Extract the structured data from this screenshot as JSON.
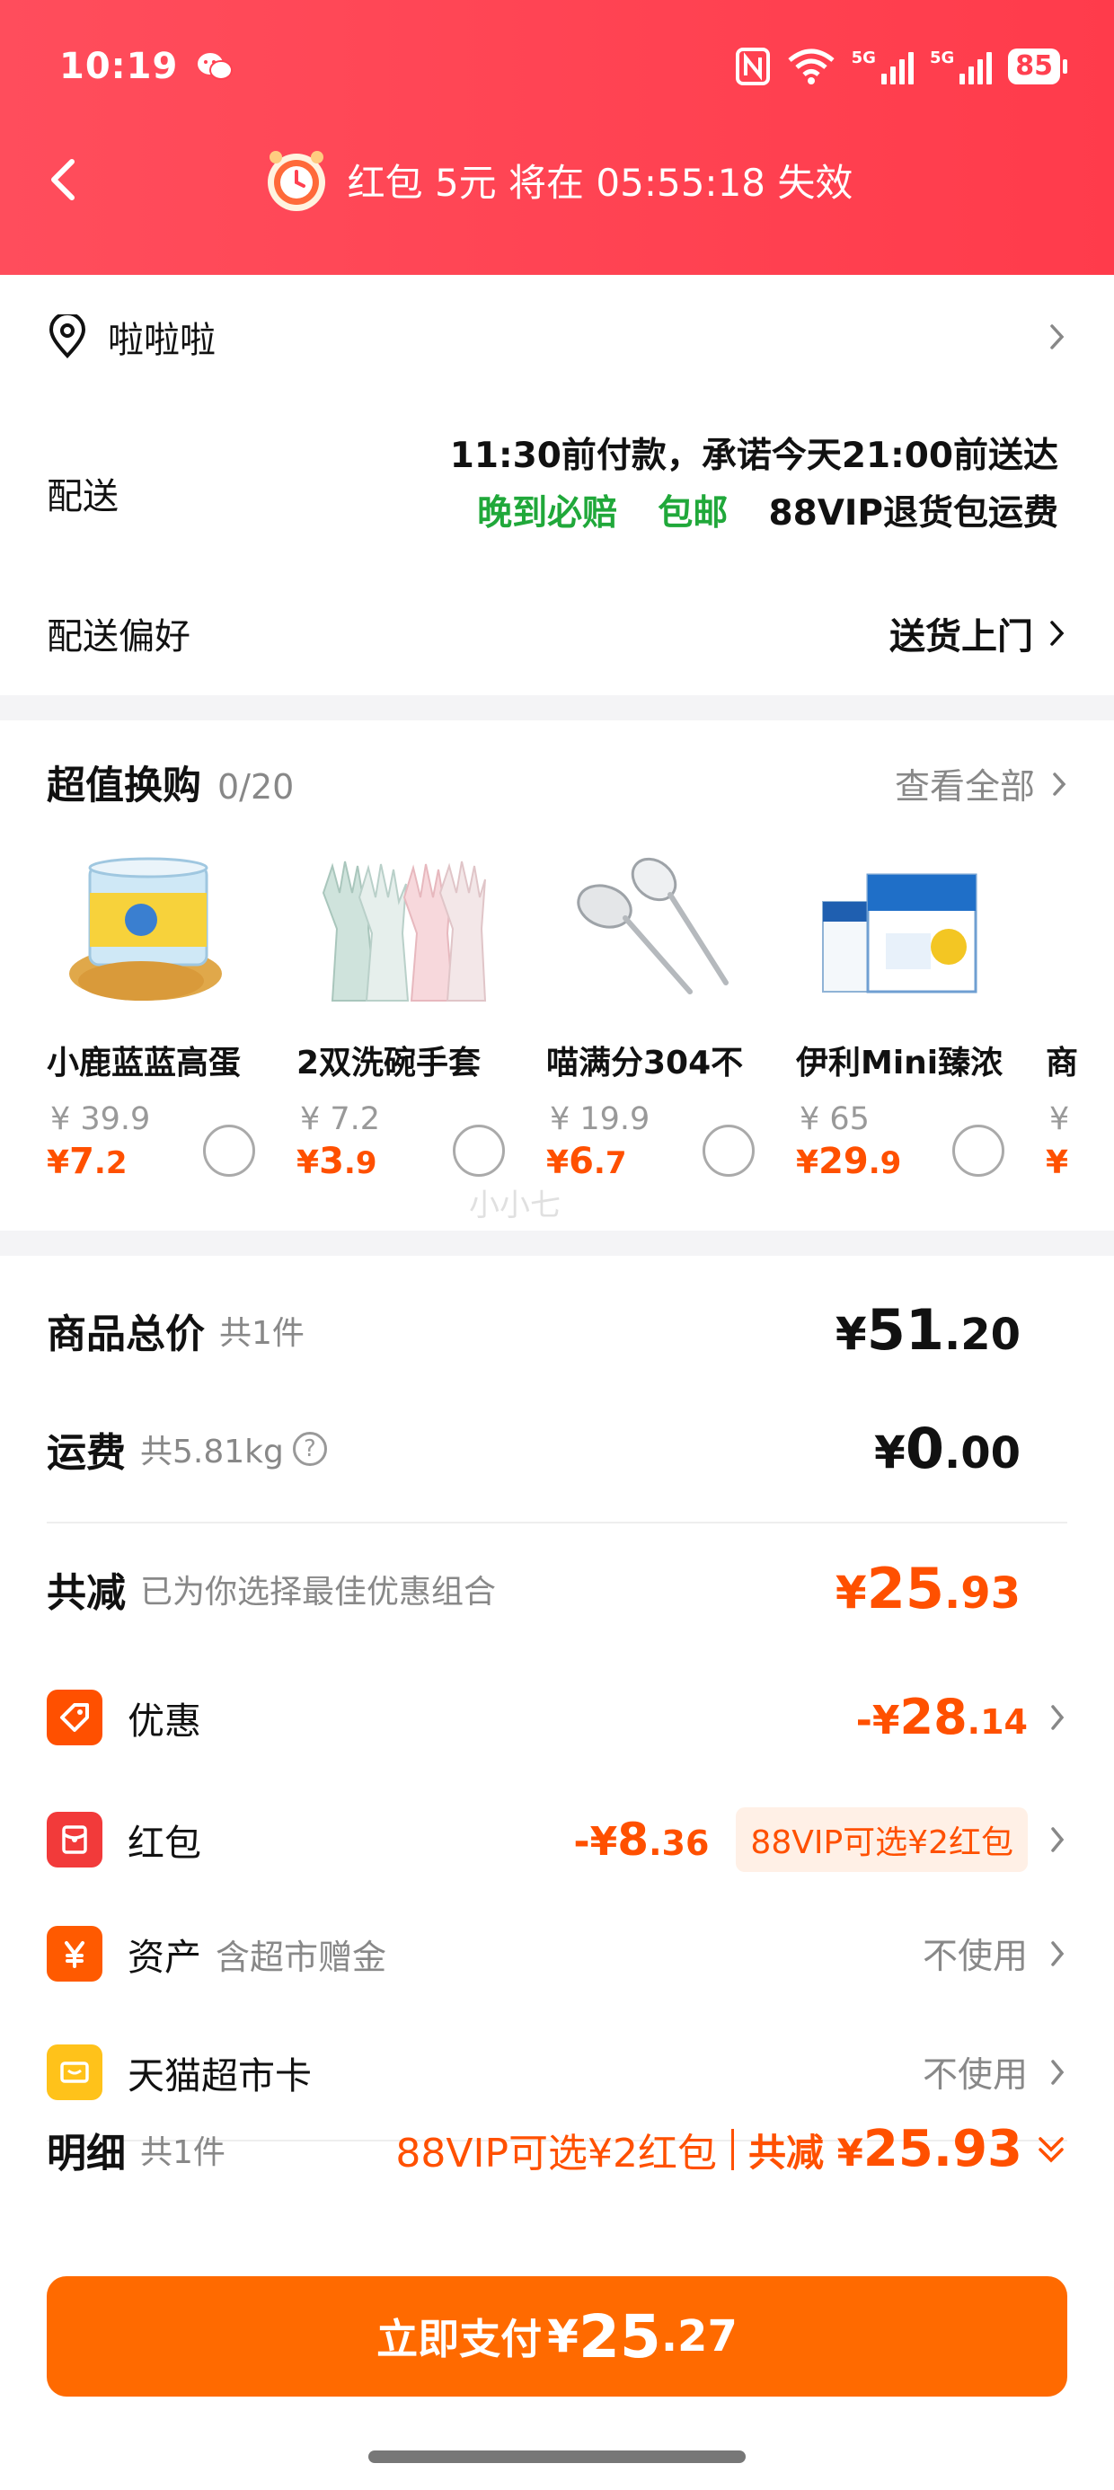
{
  "status_bar": {
    "time": "10:19",
    "signal_tag_1": "5G",
    "signal_tag_2": "5G",
    "battery": "85"
  },
  "nav": {
    "red_packet_text": "红包 5元 将在 05:55:18 失效"
  },
  "address": {
    "name": "啦啦啦"
  },
  "delivery": {
    "label": "配送",
    "line1": "11:30前付款，承诺今天21:00前送达",
    "badge1": "晚到必赔",
    "badge2": "包邮",
    "line2_rest": "88VIP退货包运费"
  },
  "preference": {
    "label": "配送偏好",
    "value": "送货上门"
  },
  "swap": {
    "title": "超值换购",
    "count": "0/20",
    "view_all": "查看全部",
    "items": [
      {
        "name": "小鹿蓝蓝高蛋",
        "orig": "¥ 39.9",
        "yen": "¥",
        "int": "7",
        "dec": ".2"
      },
      {
        "name": "2双洗碗手套",
        "orig": "¥ 7.2",
        "yen": "¥",
        "int": "3",
        "dec": ".9"
      },
      {
        "name": "喵满分304不",
        "orig": "¥ 19.9",
        "yen": "¥",
        "int": "6",
        "dec": ".7"
      },
      {
        "name": "伊利Mini臻浓",
        "orig": "¥ 65",
        "yen": "¥",
        "int": "29",
        "dec": ".9"
      },
      {
        "name": "商",
        "orig": "¥",
        "yen": "¥",
        "int": "",
        "dec": ""
      }
    ]
  },
  "watermark": "小小七",
  "summary": {
    "goods_total": {
      "label": "商品总价",
      "sub": "共1件",
      "yen": "¥",
      "int": "51",
      "dec": ".20"
    },
    "shipping": {
      "label": "运费",
      "sub": "共5.81kg",
      "help": "?",
      "yen": "¥",
      "int": "0",
      "dec": ".00"
    },
    "reduction": {
      "label": "共减",
      "sub": "已为你选择最佳优惠组合",
      "yen": "¥",
      "int": "25",
      "dec": ".93"
    },
    "discount": {
      "label": "优惠",
      "minus": "-¥",
      "int": "28",
      "dec": ".14"
    },
    "red_packet": {
      "label": "红包",
      "minus": "-¥",
      "int": "8",
      "dec": ".36",
      "pill": "88VIP可选¥2红包"
    },
    "assets": {
      "label": "资产",
      "sub": "含超市赠金",
      "value": "不使用"
    },
    "tmall_card": {
      "label": "天猫超市卡",
      "value": "不使用"
    }
  },
  "detail": {
    "label": "明细",
    "sub": "共1件",
    "promo": "88VIP可选¥2红包",
    "total_label": "共减",
    "total_yen": "¥",
    "total_amount": "25.93"
  },
  "pay": {
    "label": "立即支付",
    "yen": "¥",
    "int": "25",
    "dec": ".27"
  },
  "colors": {
    "header_red": "#ff4050",
    "accent_orange": "#ff5000",
    "pay_button": "#ff6a00",
    "green": "#20a83a"
  }
}
